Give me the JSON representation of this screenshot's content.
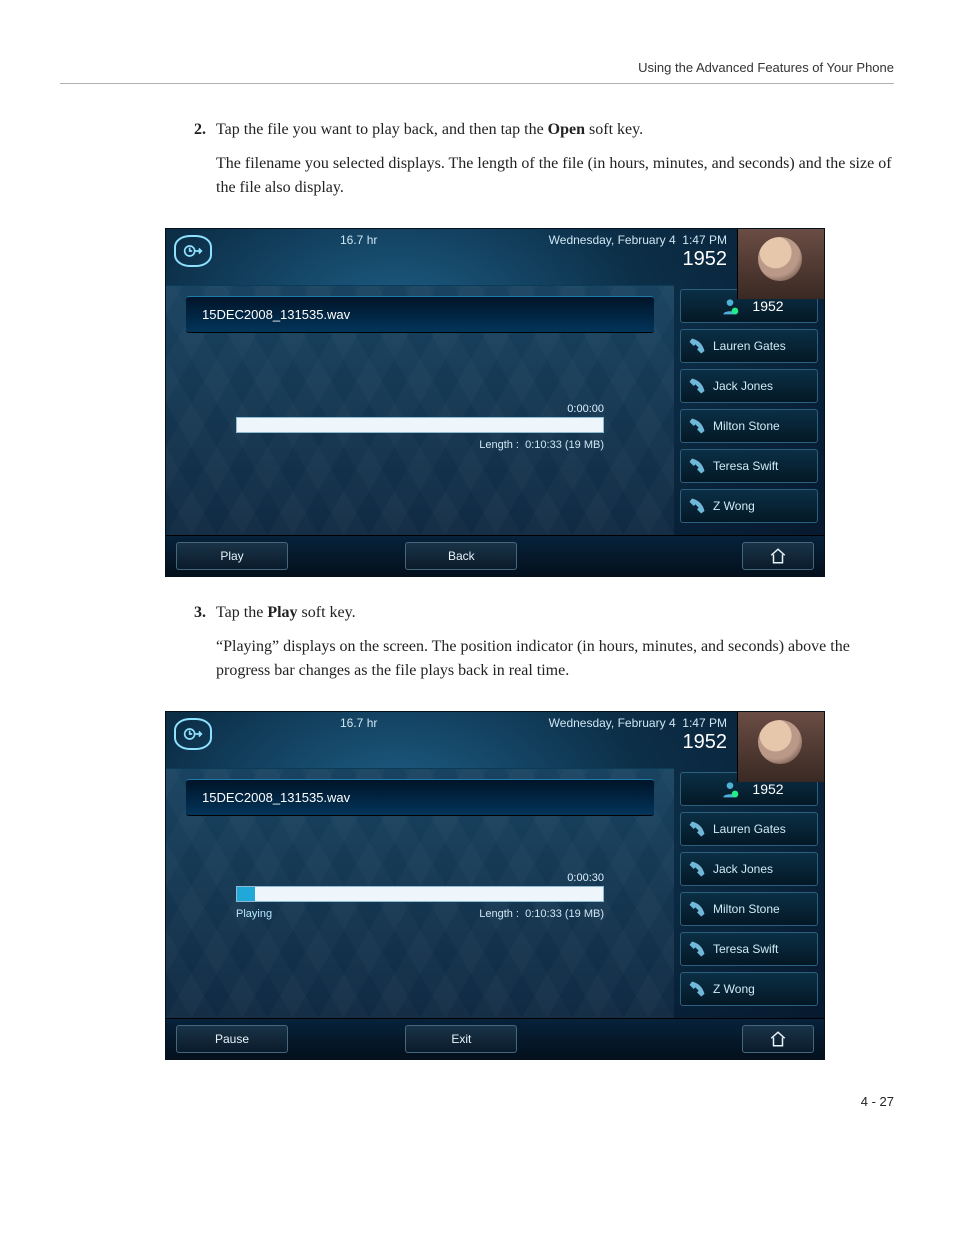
{
  "header": {
    "section_title": "Using the Advanced Features of Your Phone"
  },
  "steps": {
    "s2": {
      "num": "2.",
      "line1_a": "Tap the file you want to play back, and then tap the ",
      "line1_b": "Open",
      "line1_c": " soft key.",
      "line2": "The filename you selected displays. The length of the file (in hours, minutes, and seconds) and the size of the file also display."
    },
    "s3": {
      "num": "3.",
      "line1_a": "Tap the ",
      "line1_b": "Play",
      "line1_c": " soft key.",
      "line2": "“Playing” displays on the screen. The position indicator (in hours, minutes, and seconds) above the progress bar changes as the file plays back in real time."
    }
  },
  "phone_common": {
    "hours": "16.7 hr",
    "date": "Wednesday, February 4",
    "time": "1:47 PM",
    "extension": "1952",
    "length_label": "Length :",
    "length_value": "0:10:33 (19 MB)",
    "filename": "15DEC2008_131535.wav",
    "side_items": [
      "1952",
      "Lauren Gates",
      "Jack Jones",
      "Milton Stone",
      "Teresa Swift",
      "Z Wong"
    ]
  },
  "phone1": {
    "position": "0:00:00",
    "progress_percent": 0,
    "soft_left": "Play",
    "soft_mid": "Back"
  },
  "phone2": {
    "position": "0:00:30",
    "progress_percent": 5,
    "status": "Playing",
    "soft_left": "Pause",
    "soft_mid": "Exit"
  },
  "footer": {
    "page": "4 - 27"
  }
}
